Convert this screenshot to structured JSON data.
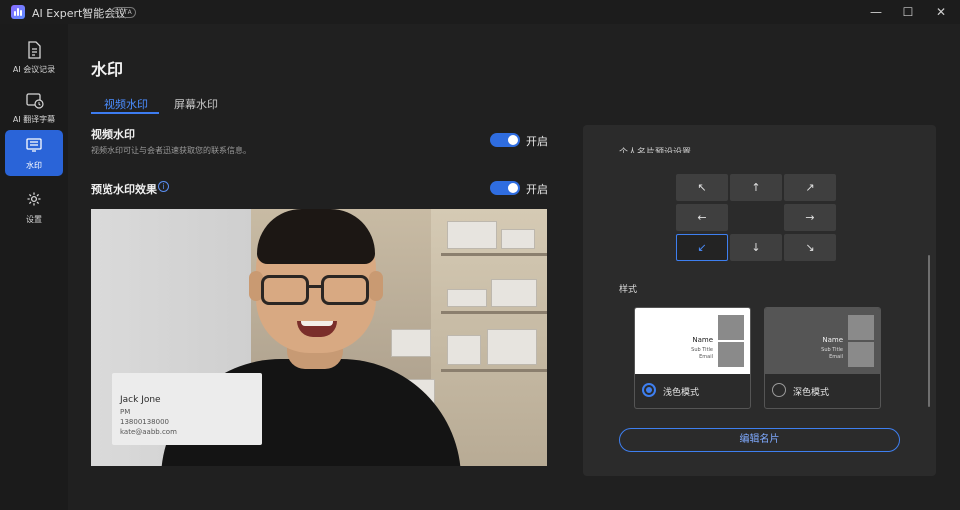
{
  "window": {
    "title": "AI Expert智能会议",
    "badge": "BETA",
    "controls": {
      "minimize": "—",
      "maximize": "☐",
      "close": "✕"
    }
  },
  "sidebar": {
    "items": [
      {
        "label": "AI 会议记录",
        "icon": "document-icon",
        "active": false
      },
      {
        "label": "AI 翻译字幕",
        "icon": "subtitle-clock-icon",
        "active": false
      },
      {
        "label": "水印",
        "icon": "monitor-watermark-icon",
        "active": true
      },
      {
        "label": "设置",
        "icon": "gear-icon",
        "active": false
      }
    ]
  },
  "main": {
    "title": "水印",
    "tabs": [
      {
        "label": "视频水印",
        "active": true
      },
      {
        "label": "屏幕水印",
        "active": false
      }
    ],
    "video_watermark": {
      "title": "视频水印",
      "description": "视频水印可让与会者迅速获取您的联系信息。",
      "toggle_label": "开启",
      "enabled": true
    },
    "preview": {
      "title": "预览水印效果",
      "info_icon": "i",
      "toggle_label": "开启",
      "enabled": true
    },
    "business_card": {
      "name": "Jack Jone",
      "title": "PM",
      "phone": "13800138000",
      "email": "kate@aabb.com"
    }
  },
  "panel": {
    "heading": "个人名片预设设置",
    "positions": [
      {
        "arrow": "↖",
        "name": "top-left"
      },
      {
        "arrow": "↑",
        "name": "top-center"
      },
      {
        "arrow": "↗",
        "name": "top-right"
      },
      {
        "arrow": "←",
        "name": "middle-left"
      },
      {
        "arrow": "",
        "name": "center"
      },
      {
        "arrow": "→",
        "name": "middle-right"
      },
      {
        "arrow": "↙",
        "name": "bottom-left",
        "selected": true
      },
      {
        "arrow": "↓",
        "name": "bottom-center"
      },
      {
        "arrow": "↘",
        "name": "bottom-right"
      }
    ],
    "style_label": "样式",
    "styles": [
      {
        "label": "浅色模式",
        "selected": true,
        "preview": {
          "name": "Name",
          "sub": "Sub Title",
          "mail": "Email"
        }
      },
      {
        "label": "深色模式",
        "selected": false,
        "preview": {
          "name": "Name",
          "sub": "Sub Title",
          "mail": "Email"
        }
      }
    ],
    "edit_button": "编辑名片"
  },
  "colors": {
    "accent": "#2f6de0",
    "background": "#202020",
    "panel": "#2b2b2b"
  }
}
